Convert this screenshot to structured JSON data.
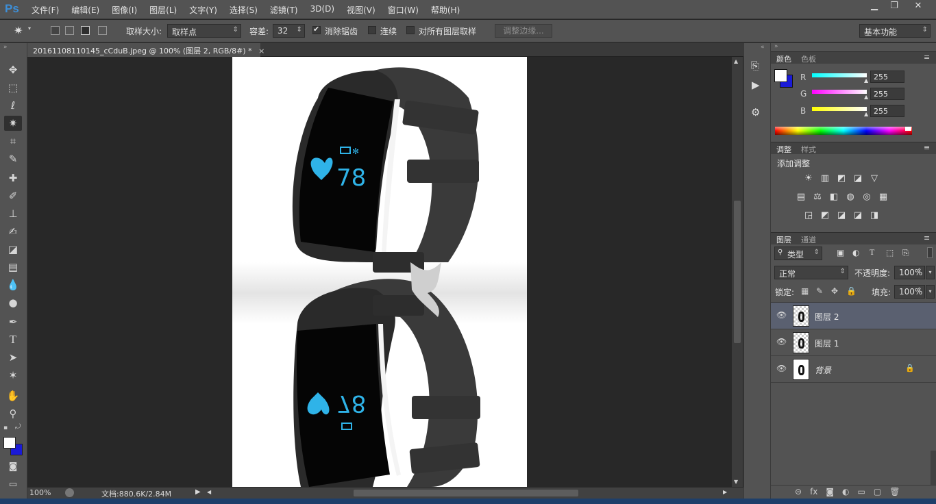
{
  "app": {
    "logo": "Ps"
  },
  "menu": [
    "文件(F)",
    "编辑(E)",
    "图像(I)",
    "图层(L)",
    "文字(Y)",
    "选择(S)",
    "滤镜(T)",
    "3D(D)",
    "视图(V)",
    "窗口(W)",
    "帮助(H)"
  ],
  "window_controls": {
    "minimize": "▁",
    "restore": "❐",
    "close": "✕"
  },
  "options": {
    "sample_size_label": "取样大小:",
    "sample_size_value": "取样点",
    "tolerance_label": "容差:",
    "tolerance_value": "32",
    "antialias_label": "消除锯齿",
    "antialias_checked": true,
    "contiguous_label": "连续",
    "contiguous_checked": false,
    "sample_all_label": "对所有图层取样",
    "sample_all_checked": false,
    "refine_edge_label": "调整边缘...",
    "workspace_value": "基本功能"
  },
  "document": {
    "tab_title": "20161108110145_cCduB.jpeg @ 100% (图层 2, RGB/8#) *",
    "tab_close": "×"
  },
  "watch": {
    "bpm": "78",
    "bpm_mirrored": "78"
  },
  "status": {
    "zoom": "100%",
    "doc_info": "文档:880.6K/2.84M"
  },
  "color_panel": {
    "tabs": [
      "颜色",
      "色板"
    ],
    "channels": [
      {
        "label": "R",
        "value": "255"
      },
      {
        "label": "G",
        "value": "255"
      },
      {
        "label": "B",
        "value": "255"
      }
    ],
    "foreground": "#ffffff",
    "background": "#1a1ad8"
  },
  "adjust_panel": {
    "tabs": [
      "调整",
      "样式"
    ],
    "title": "添加调整",
    "row1": [
      "☀",
      "▥",
      "◩",
      "◪",
      "▽"
    ],
    "row2": [
      "▤",
      "⚖",
      "◧",
      "◍",
      "◎",
      "▦"
    ],
    "row3": [
      "◲",
      "◩",
      "◪",
      "◪",
      "◨"
    ]
  },
  "layers_panel": {
    "tabs": [
      "图层",
      "通道"
    ],
    "filter_kind": "类型",
    "blend_mode": "正常",
    "opacity_label": "不透明度:",
    "opacity_value": "100%",
    "lock_label": "锁定:",
    "fill_label": "填充:",
    "fill_value": "100%",
    "layers": [
      {
        "name": "图层 2",
        "selected": true
      },
      {
        "name": "图层 1",
        "selected": false
      },
      {
        "name": "背景",
        "selected": false,
        "locked": true
      }
    ],
    "footer_icons": [
      "⊝",
      "fx",
      "◙",
      "◐",
      "▭",
      "▢",
      "🗑"
    ]
  }
}
